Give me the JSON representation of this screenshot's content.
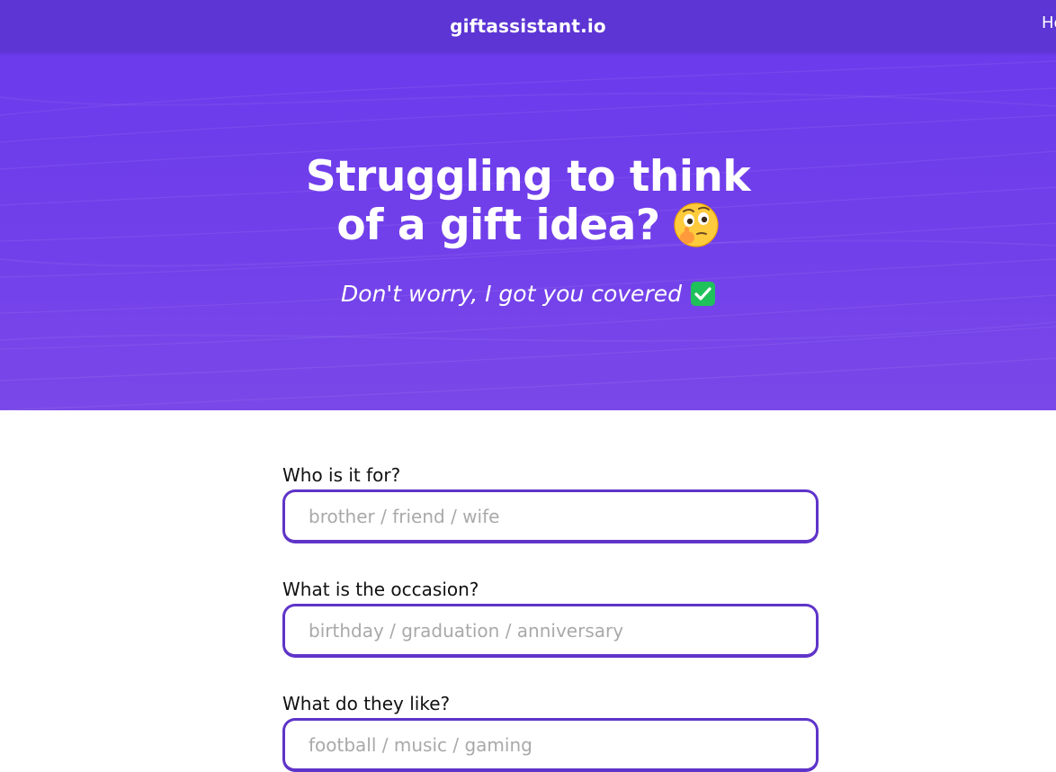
{
  "nav": {
    "brand": "giftassistant.io",
    "link_partial": "Ho"
  },
  "hero": {
    "title_line1": "Struggling to think",
    "title_line2": "of a gift idea?",
    "title_emoji": "thinking-face-icon",
    "subtitle": "Don't worry, I got you covered",
    "subtitle_emoji": "check-mark-box-icon"
  },
  "form": {
    "fields": [
      {
        "label": "Who is it for?",
        "placeholder": "brother / friend / wife",
        "value": ""
      },
      {
        "label": "What is the occasion?",
        "placeholder": "birthday / graduation / anniversary",
        "value": ""
      },
      {
        "label": "What do they like?",
        "placeholder": "football / music / gaming",
        "value": ""
      }
    ]
  },
  "colors": {
    "nav_bg": "#5c35d4",
    "hero_bg": "#7240ea",
    "input_border": "#5f34c9",
    "check_green": "#1fc15a"
  }
}
